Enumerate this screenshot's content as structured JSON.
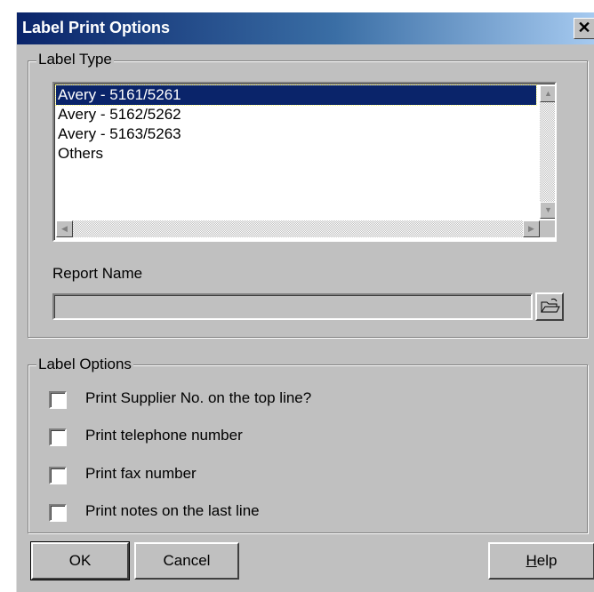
{
  "dialog": {
    "title": "Label Print Options",
    "close_glyph": "✕"
  },
  "label_type": {
    "legend": "Label Type",
    "items": [
      "Avery - 5161/5261",
      "Avery - 5162/5262",
      "Avery - 5163/5263",
      "Others"
    ],
    "selected_index": 0
  },
  "report": {
    "label": "Report Name",
    "value": "",
    "browse_icon": "folder-open-icon"
  },
  "label_options": {
    "legend": "Label Options",
    "checkboxes": [
      {
        "label": "Print Supplier No. on the top line?",
        "checked": false
      },
      {
        "label": "Print telephone number",
        "checked": false
      },
      {
        "label": "Print fax number",
        "checked": false
      },
      {
        "label": "Print notes on the last line",
        "checked": false
      }
    ]
  },
  "buttons": {
    "ok": "OK",
    "cancel": "Cancel",
    "help_first": "H",
    "help_rest": "elp"
  },
  "colors": {
    "selection": "#0a246a",
    "dialog_bg": "#c0c0c0",
    "title_gradient_start": "#0a246a"
  }
}
